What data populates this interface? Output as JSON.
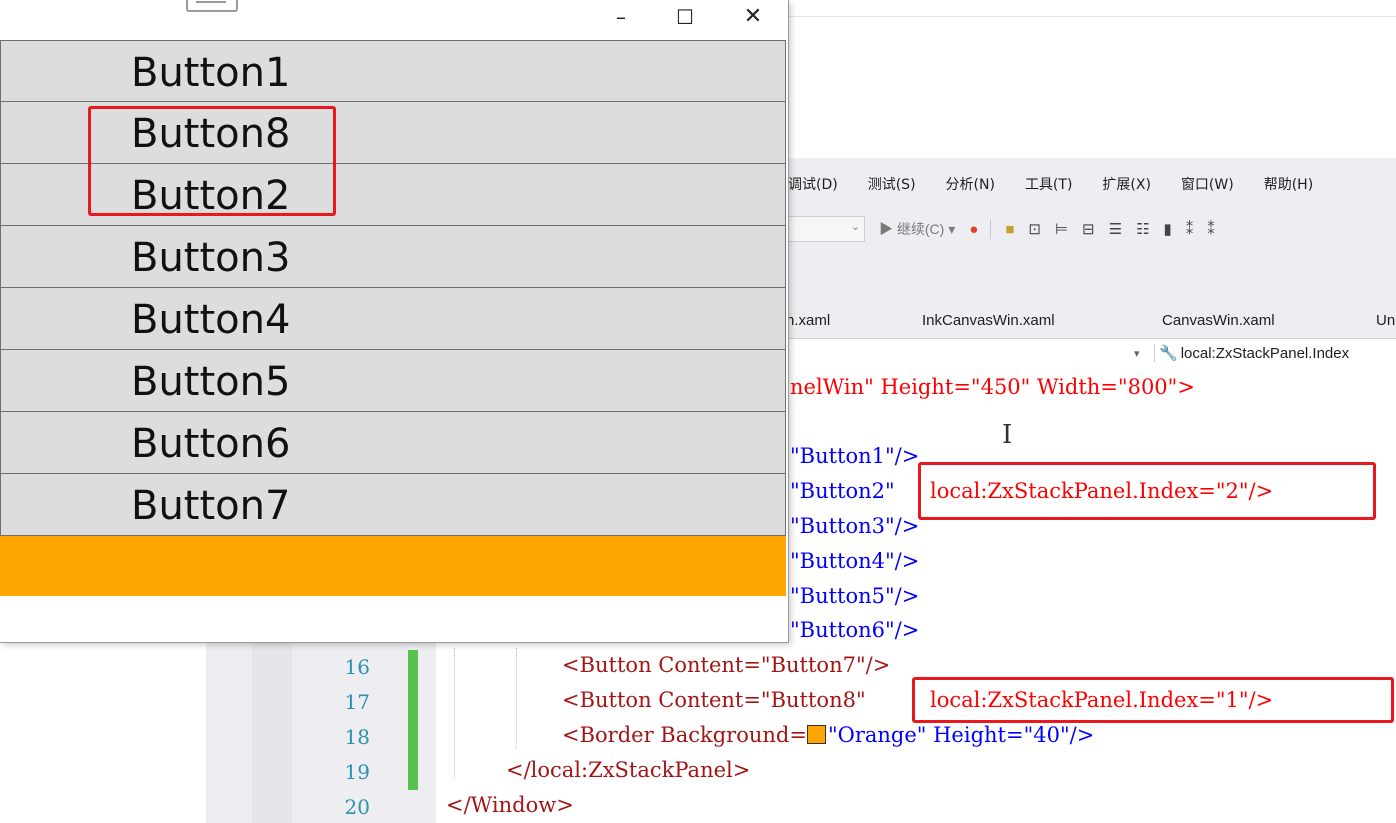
{
  "editor": {
    "menu": [
      "调试(D)",
      "测试(S)",
      "分析(N)",
      "工具(T)",
      "扩展(X)",
      "窗口(W)",
      "帮助(H)"
    ],
    "toolbar": {
      "continue_label": "继续(C)"
    },
    "tabs": [
      "n.xaml",
      "InkCanvasWin.xaml",
      "CanvasWin.xaml",
      "Un"
    ],
    "nav_member": "local:ZxStackPanel.Index",
    "code": {
      "window_fragment": "nelWin\" Height=\"450\" Width=\"800\">",
      "b1": "\"Button1\"/>",
      "b2": "\"Button2\"",
      "b2_idx": "local:ZxStackPanel.Index=\"2\"/>",
      "b3": "\"Button3\"/>",
      "b4": "\"Button4\"/>",
      "b5": "\"Button5\"/>",
      "b6": "\"Button6\"/>",
      "line16": "<Button Content=\"Button7\"/>",
      "line17": "<Button Content=\"Button8\"",
      "line17_idx": "local:ZxStackPanel.Index=\"1\"/>",
      "line18_a": "<Border Background=",
      "line18_b": "\"Orange\" Height=\"40\"/>",
      "line19": "</local:ZxStackPanel>",
      "line20": "</Window>"
    },
    "line_numbers": [
      "16",
      "17",
      "18",
      "19",
      "20"
    ],
    "orange_swatch_color": "#ffa500"
  },
  "wpf_window": {
    "buttons": [
      "Button1",
      "Button8",
      "Button2",
      "Button3",
      "Button4",
      "Button5",
      "Button6",
      "Button7"
    ],
    "orange_border_color": "#ffa500"
  }
}
